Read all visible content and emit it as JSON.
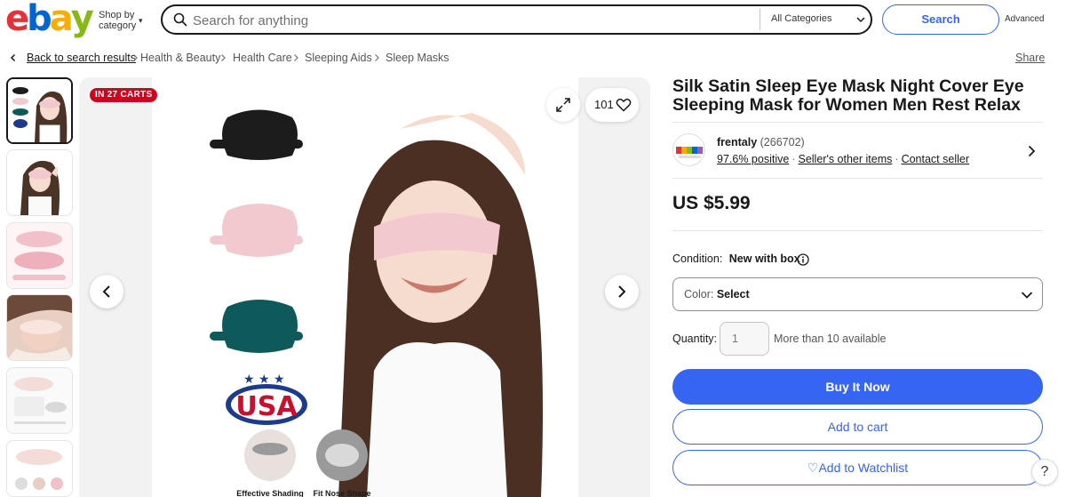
{
  "header": {
    "logo_letters": [
      "e",
      "b",
      "a",
      "y"
    ],
    "logo_colors": [
      "#e53238",
      "#0064d2",
      "#f5af02",
      "#86b817"
    ],
    "shop_by_line1": "Shop by",
    "shop_by_line2": "category",
    "search_placeholder": "Search for anything",
    "category_select": "All Categories",
    "search_button": "Search",
    "advanced_link": "Advanced"
  },
  "breadcrumb": {
    "back": "Back to search results",
    "items": [
      "Health & Beauty",
      "Health Care",
      "Sleeping Aids",
      "Sleep Masks"
    ],
    "share": "Share"
  },
  "gallery": {
    "badge": "IN 27 CARTS",
    "watch_count": "101",
    "image_labels": [
      "Effective Shading",
      "Fit Nose Shape"
    ],
    "usa_text": "USA"
  },
  "listing": {
    "title": "Silk Satin Sleep Eye Mask Night Cover Eye Sleeping Mask for Women Men Rest Relax",
    "seller_name": "frentaly",
    "seller_score": "(266702)",
    "seller_positive": "97.6% positive",
    "seller_other_items": "Seller's other items",
    "contact_seller": "Contact seller",
    "price": "US $5.99",
    "condition_label": "Condition:",
    "condition_value": "New with box",
    "color_label": "Color:",
    "color_value": "Select",
    "quantity_label": "Quantity:",
    "quantity_value": "1",
    "availability": "More than 10 available",
    "buy_it_now": "Buy It Now",
    "add_to_cart": "Add to cart",
    "add_to_watchlist": "Add to Watchlist",
    "help": "?"
  },
  "colors": {
    "accent_blue": "#3665f3",
    "badge_red": "#d2001e",
    "mask_black": "#1c1c1c",
    "mask_pink": "#f2c9cf",
    "mask_teal": "#0e5a5a"
  }
}
